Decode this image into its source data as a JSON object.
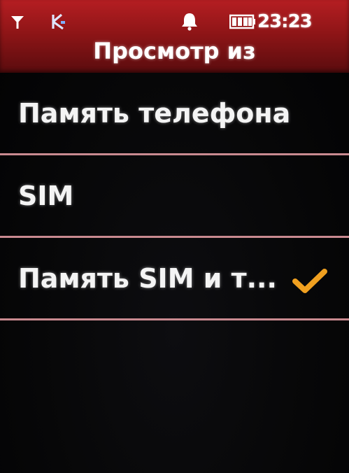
{
  "status_bar": {
    "time": "23:23",
    "icons": [
      "signal-icon",
      "network-icon",
      "alarm-icon",
      "battery-icon"
    ]
  },
  "title": "Просмотр из",
  "options": [
    {
      "label": "Память телефона",
      "selected": false
    },
    {
      "label": "SIM",
      "selected": false
    },
    {
      "label": "Память SIM и т...",
      "selected": true
    }
  ],
  "colors": {
    "header": "#9c1a1c",
    "divider": "#c98a90",
    "checkmark": "#f0a020",
    "background": "#050506"
  }
}
